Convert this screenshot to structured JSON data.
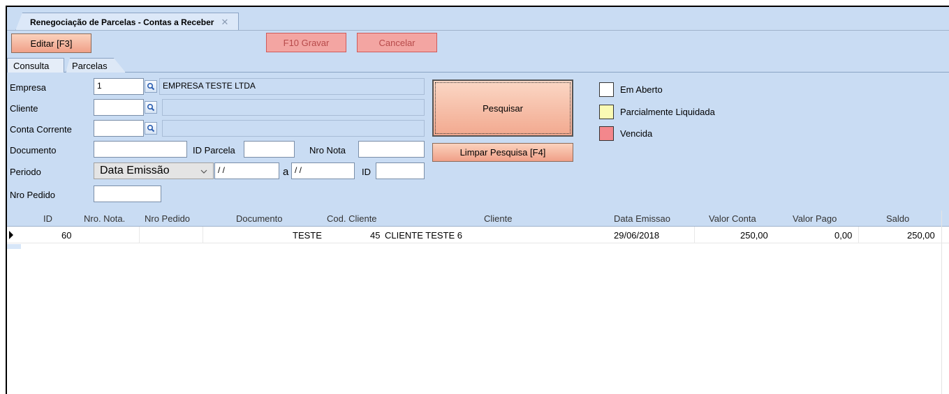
{
  "document_tab": {
    "title": "Renegociação de Parcelas - Contas a Receber",
    "close_glyph": "✕"
  },
  "toolbar": {
    "edit_label": "Editar [F3]",
    "save_label": "F10 Gravar",
    "cancel_label": "Cancelar"
  },
  "section_tabs": {
    "consulta": "Consulta",
    "parcelas": "Parcelas"
  },
  "form": {
    "empresa_label": "Empresa",
    "empresa_code": "1",
    "empresa_name": "EMPRESA TESTE LTDA",
    "cliente_label": "Cliente",
    "cliente_code": "",
    "cliente_name": "",
    "conta_label": "Conta Corrente",
    "conta_code": "",
    "conta_name": "",
    "documento_label": "Documento",
    "documento_value": "",
    "id_parcela_label": "ID Parcela",
    "id_parcela_value": "",
    "nro_nota_label": "Nro Nota",
    "nro_nota_value": "",
    "periodo_label": "Periodo",
    "periodo_type": "Data Emissão",
    "periodo_from": " / /",
    "periodo_sep": "a",
    "periodo_to": " / /",
    "id_label": "ID",
    "id_value": "",
    "nro_pedido_label": "Nro Pedido",
    "nro_pedido_value": ""
  },
  "actions": {
    "pesquisar": "Pesquisar",
    "limpar": "Limpar Pesquisa [F4]"
  },
  "legend": [
    {
      "label": "Em Aberto",
      "color": "#ffffff"
    },
    {
      "label": "Parcialmente Liquidada",
      "color": "#fafab4"
    },
    {
      "label": "Vencida",
      "color": "#f3878c"
    }
  ],
  "grid": {
    "columns": [
      "ID",
      "Nro. Nota.",
      "Nro Pedido",
      "Documento",
      "Cod. Cliente",
      "Cliente",
      "Data Emissao",
      "Valor Conta",
      "Valor Pago",
      "Saldo"
    ],
    "rows": [
      {
        "id": "60",
        "nro_nota": "",
        "nro_pedido": "",
        "documento": "TESTE",
        "cod_cliente": "45",
        "cliente": "CLIENTE TESTE 6",
        "data_emissao": "29/06/2018",
        "valor_conta": "250,00",
        "valor_pago": "0,00",
        "saldo": "250,00"
      }
    ]
  }
}
